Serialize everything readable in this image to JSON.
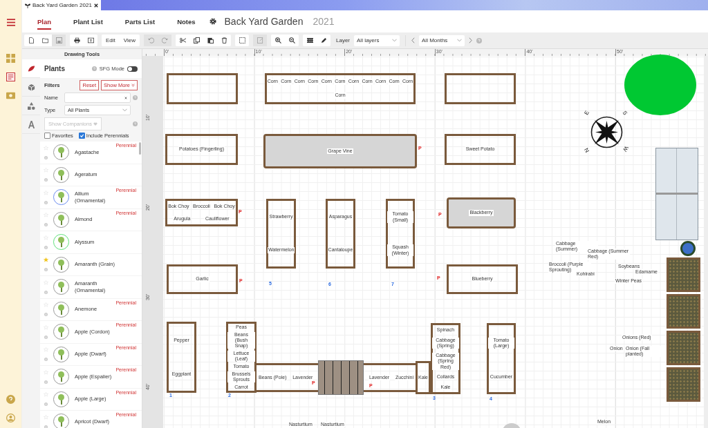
{
  "browser_tab": {
    "title": "Back Yard Garden",
    "year": "2021"
  },
  "nav_tabs": [
    {
      "label": "Plan",
      "selected": true
    },
    {
      "label": "Plant List",
      "selected": false
    },
    {
      "label": "Parts List",
      "selected": false
    },
    {
      "label": "Notes",
      "selected": false
    }
  ],
  "plan": {
    "title": "Back Yard Garden",
    "year": "2021"
  },
  "toolbar": {
    "edit": "Edit",
    "view": "View",
    "layer_label": "Layer",
    "layer_value": "All layers",
    "month_value": "All Months"
  },
  "panel": {
    "header": "Drawing Tools",
    "tools": [
      {
        "kind": "plants",
        "selected": true
      },
      {
        "kind": "structures",
        "selected": false
      },
      {
        "kind": "shapes",
        "selected": false
      },
      {
        "kind": "text",
        "selected": false
      }
    ],
    "heading": "Plants",
    "sfg_label": "SFG Mode",
    "sfg_on": false,
    "filters_label": "Filters",
    "reset": "Reset",
    "show_more": "Show More",
    "name_label": "Name",
    "type_label": "Type",
    "type_value": "All Plants",
    "companions": "Show Companions",
    "checkboxes": [
      {
        "label": "Favorites",
        "checked": false
      },
      {
        "label": "Include Perennials",
        "checked": true
      }
    ]
  },
  "plants": [
    {
      "name": "Agastache",
      "badge": "Perennial",
      "favorite": false,
      "color": "#9a9a9a"
    },
    {
      "name": "Ageratum",
      "favorite": false,
      "color": "#9a9a9a"
    },
    {
      "name": "Allium (Ornamental)",
      "badge": "Perennial",
      "favorite": false,
      "color": "#6b8cf0"
    },
    {
      "name": "Almond",
      "badge": "Perennial",
      "favorite": false,
      "color": "#9a9a9a"
    },
    {
      "name": "Alyssum",
      "favorite": false,
      "color": "#5ee07a"
    },
    {
      "name": "Amaranth (Grain)",
      "favorite": true,
      "color": "#9a9a9a"
    },
    {
      "name": "Amaranth (Ornamental)",
      "favorite": false,
      "color": "#9a9a9a"
    },
    {
      "name": "Anemone",
      "badge": "Perennial",
      "favorite": false,
      "color": "#9a9a9a"
    },
    {
      "name": "Apple (Cordon)",
      "badge": "Perennial",
      "favorite": false,
      "color": "#9a9a9a"
    },
    {
      "name": "Apple (Dwarf)",
      "badge": "Perennial",
      "favorite": false,
      "color": "#9a9a9a"
    },
    {
      "name": "Apple (Espalier)",
      "badge": "Perennial",
      "favorite": false,
      "color": "#9a9a9a"
    },
    {
      "name": "Apple (Large)",
      "badge": "Perennial",
      "favorite": false,
      "color": "#9a9a9a"
    },
    {
      "name": "Apricot (Dwarf)",
      "badge": "Perennial",
      "favorite": false,
      "color": "#9a9a9a"
    }
  ],
  "canvas": {
    "ruler_top": [
      "0'",
      "10'",
      "20'",
      "30'",
      "40'",
      "50'"
    ],
    "ruler_left": [
      "10'",
      "20'",
      "30'",
      "40'"
    ],
    "beds": [
      {
        "kind": "bed"
      },
      {
        "kind": "bed",
        "labels": [
          "Corn",
          "Corn",
          "Corn",
          "Corn",
          "Corn",
          "Corn",
          "Corn",
          "Corn",
          "Corn",
          "Corn",
          "Corn",
          "Corn"
        ]
      },
      {
        "kind": "bed"
      },
      {
        "kind": "bed",
        "labels": [
          "Potatoes (Fingerling)"
        ]
      },
      {
        "kind": "trellis",
        "labels": [
          "Grape Vine"
        ]
      },
      {
        "kind": "bed",
        "labels": [
          "Sweet Potato"
        ]
      },
      {
        "kind": "bed",
        "labels": [
          "Bok Choy",
          "Broccoli",
          "Bok Choy",
          "Arugula",
          "Cauliflower"
        ]
      },
      {
        "kind": "bed",
        "labels": [
          "Strawberry",
          "Watermelon"
        ]
      },
      {
        "kind": "bed",
        "labels": [
          "Asparagus",
          "Cantaloupe"
        ]
      },
      {
        "kind": "bed",
        "labels": [
          "Tomato (Small)",
          "Squash (Winter)"
        ]
      },
      {
        "kind": "trellis",
        "labels": [
          "Blackberry"
        ]
      },
      {
        "kind": "bed",
        "labels": [
          "Garlic"
        ]
      },
      {
        "kind": "bed",
        "labels": [
          "Blueberry"
        ]
      },
      {
        "kind": "bed",
        "labels": [
          "Pepper",
          "Eggplant"
        ]
      },
      {
        "kind": "bed",
        "labels": [
          "Peas",
          "Beans (Bush Snap)",
          "Lettuce (Leaf)",
          "Tomato",
          "Brussels Sprouts",
          "Carrot"
        ]
      },
      {
        "kind": "path",
        "labels": [
          "Beans (Pole)",
          "Lavender",
          "Lavender",
          "Zucchini"
        ]
      },
      {
        "kind": "bed",
        "labels": [
          "Kale"
        ]
      },
      {
        "kind": "bed",
        "labels": [
          "Spinach",
          "Cabbage (Spring)",
          "Cabbage (Spring Red)",
          "Collards",
          "Kale"
        ]
      },
      {
        "kind": "bed",
        "labels": [
          "Tomato (Large)",
          "Cucumber"
        ]
      }
    ],
    "markers": [
      {
        "kind": "p",
        "text": "P"
      },
      {
        "kind": "p",
        "text": "P"
      },
      {
        "kind": "number",
        "text": "5"
      },
      {
        "kind": "number",
        "text": "6"
      },
      {
        "kind": "number",
        "text": "7"
      },
      {
        "kind": "p",
        "text": "P"
      },
      {
        "kind": "p",
        "text": "P"
      },
      {
        "kind": "p",
        "text": "P"
      },
      {
        "kind": "number",
        "text": "1"
      },
      {
        "kind": "number",
        "text": "2"
      },
      {
        "kind": "p",
        "text": "P"
      },
      {
        "kind": "p",
        "text": "P"
      },
      {
        "kind": "number",
        "text": "3"
      },
      {
        "kind": "number",
        "text": "4"
      }
    ],
    "loose_plants": [
      {
        "name": "Cabbage (Summer)"
      },
      {
        "name": "Cabbage (Summer Red)"
      },
      {
        "name": "Broccoli (Purple Sprouting)"
      },
      {
        "name": "Kohlrabi"
      },
      {
        "name": "Soybeans"
      },
      {
        "name": "Edamame"
      },
      {
        "name": "Winter Peas"
      },
      {
        "name": "Onions (Red)"
      },
      {
        "name": "Onion"
      },
      {
        "name": "Onion (Fall planted)"
      },
      {
        "name": "Nasturtium"
      },
      {
        "name": "Nasturtium"
      },
      {
        "name": "Melon"
      }
    ],
    "compass": [
      "E",
      "S",
      "W",
      "N"
    ]
  }
}
